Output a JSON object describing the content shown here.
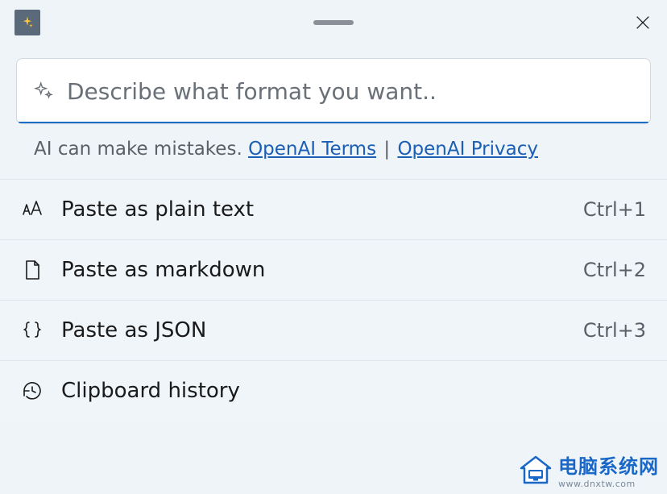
{
  "input": {
    "placeholder": "Describe what format you want..",
    "value": ""
  },
  "disclaimer": {
    "text": "AI can make mistakes. ",
    "link1_label": "OpenAI Terms",
    "separator": " | ",
    "link2_label": "OpenAI Privacy"
  },
  "menu": {
    "items": [
      {
        "label": "Paste as plain text",
        "shortcut": "Ctrl+1"
      },
      {
        "label": "Paste as markdown",
        "shortcut": "Ctrl+2"
      },
      {
        "label": "Paste as JSON",
        "shortcut": "Ctrl+3"
      },
      {
        "label": "Clipboard history",
        "shortcut": ""
      }
    ]
  },
  "watermark": {
    "title": "电脑系统网",
    "url": "www.dnxtw.com"
  }
}
